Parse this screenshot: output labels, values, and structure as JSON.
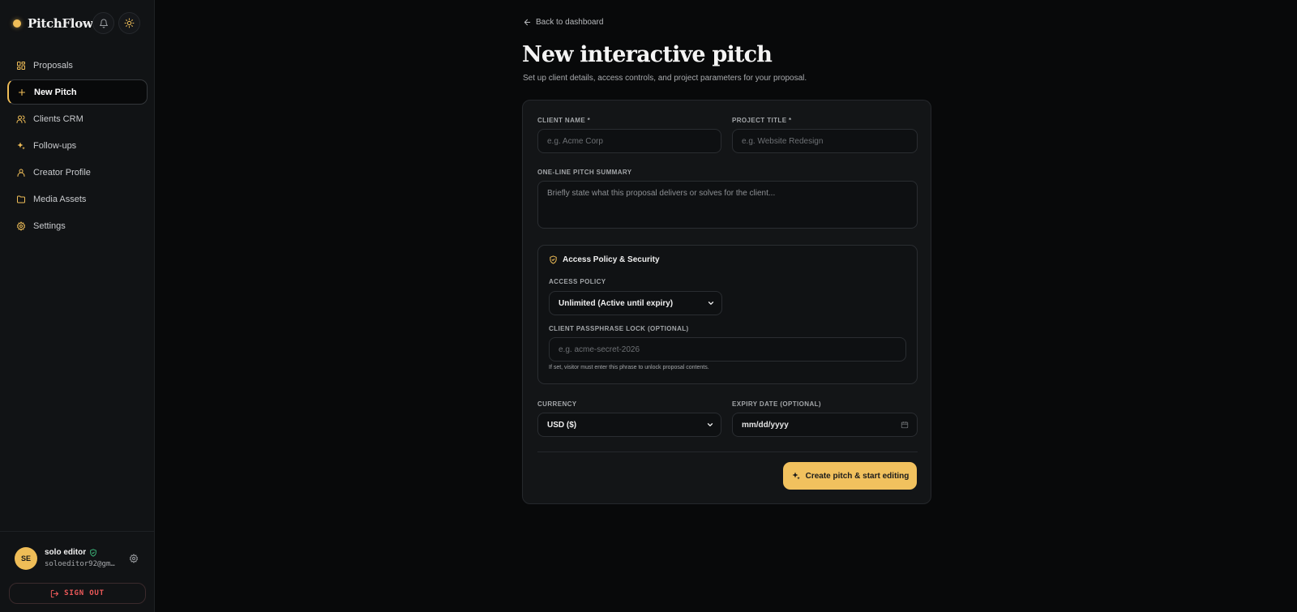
{
  "app": {
    "name": "PitchFlow",
    "accent": "#efbd57",
    "danger": "#ef5a5a",
    "success": "#3fbf7f"
  },
  "sidebar": {
    "items": [
      {
        "label": "Proposals",
        "icon": "grid-icon"
      },
      {
        "label": "New Pitch",
        "icon": "plus-icon",
        "active": true
      },
      {
        "label": "Clients CRM",
        "icon": "users-icon"
      },
      {
        "label": "Follow-ups",
        "icon": "sparkles-icon"
      },
      {
        "label": "Creator Profile",
        "icon": "user-icon"
      },
      {
        "label": "Media Assets",
        "icon": "folder-icon"
      },
      {
        "label": "Settings",
        "icon": "gear-icon"
      }
    ],
    "user": {
      "initials": "SE",
      "name": "solo editor",
      "email": "soloeditor92@gm…"
    },
    "signout_label": "SIGN OUT"
  },
  "main": {
    "back_label": "Back to dashboard",
    "title": "New interactive pitch",
    "subtitle": "Set up client details, access controls, and project parameters for your proposal.",
    "form": {
      "client_name": {
        "label": "CLIENT NAME *",
        "placeholder": "e.g. Acme Corp"
      },
      "project_title": {
        "label": "PROJECT TITLE *",
        "placeholder": "e.g. Website Redesign"
      },
      "summary": {
        "label": "ONE-LINE PITCH SUMMARY",
        "placeholder": "Briefly state what this proposal delivers or solves for the client..."
      },
      "security": {
        "title": "Access Policy & Security",
        "access_policy": {
          "label": "ACCESS POLICY",
          "value": "Unlimited (Active until expiry)"
        },
        "passphrase": {
          "label": "CLIENT PASSPHRASE LOCK (OPTIONAL)",
          "placeholder": "e.g. acme-secret-2026",
          "hint": "If set, visitor must enter this phrase to unlock proposal contents."
        }
      },
      "currency": {
        "label": "CURRENCY",
        "value": "USD ($)"
      },
      "expiry": {
        "label": "EXPIRY DATE (OPTIONAL)",
        "value": "mm/dd/yyyy"
      },
      "submit_label": "Create pitch & start editing"
    }
  }
}
